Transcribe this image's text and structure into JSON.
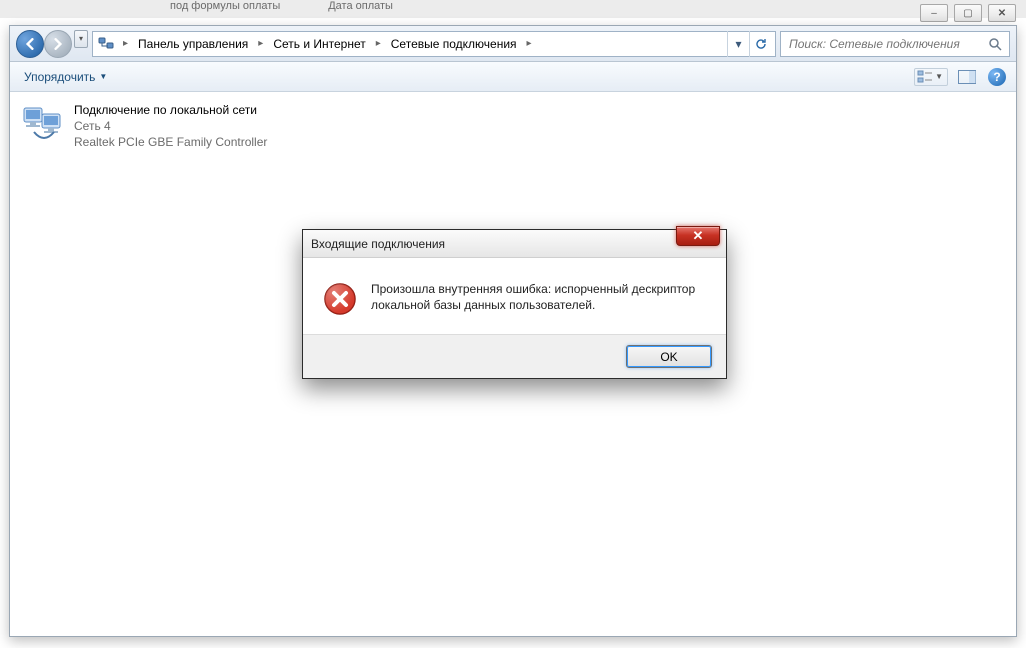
{
  "top_strip": {
    "item1": "под формулы оплаты",
    "item2": "Дата оплаты"
  },
  "window_controls": {
    "min": "–",
    "max": "▢",
    "close": "✕"
  },
  "breadcrumbs": [
    "Панель управления",
    "Сеть и Интернет",
    "Сетевые подключения"
  ],
  "search": {
    "placeholder": "Поиск: Сетевые подключения"
  },
  "toolbar": {
    "organize": "Упорядочить"
  },
  "connection": {
    "title": "Подключение по локальной сети",
    "network": "Сеть 4",
    "adapter": "Realtek PCIe GBE Family Controller"
  },
  "dialog": {
    "title": "Входящие подключения",
    "message": "Произошла внутренняя ошибка: испорченный дескриптор локальной базы данных пользователей.",
    "ok": "OK",
    "close": "✕"
  }
}
